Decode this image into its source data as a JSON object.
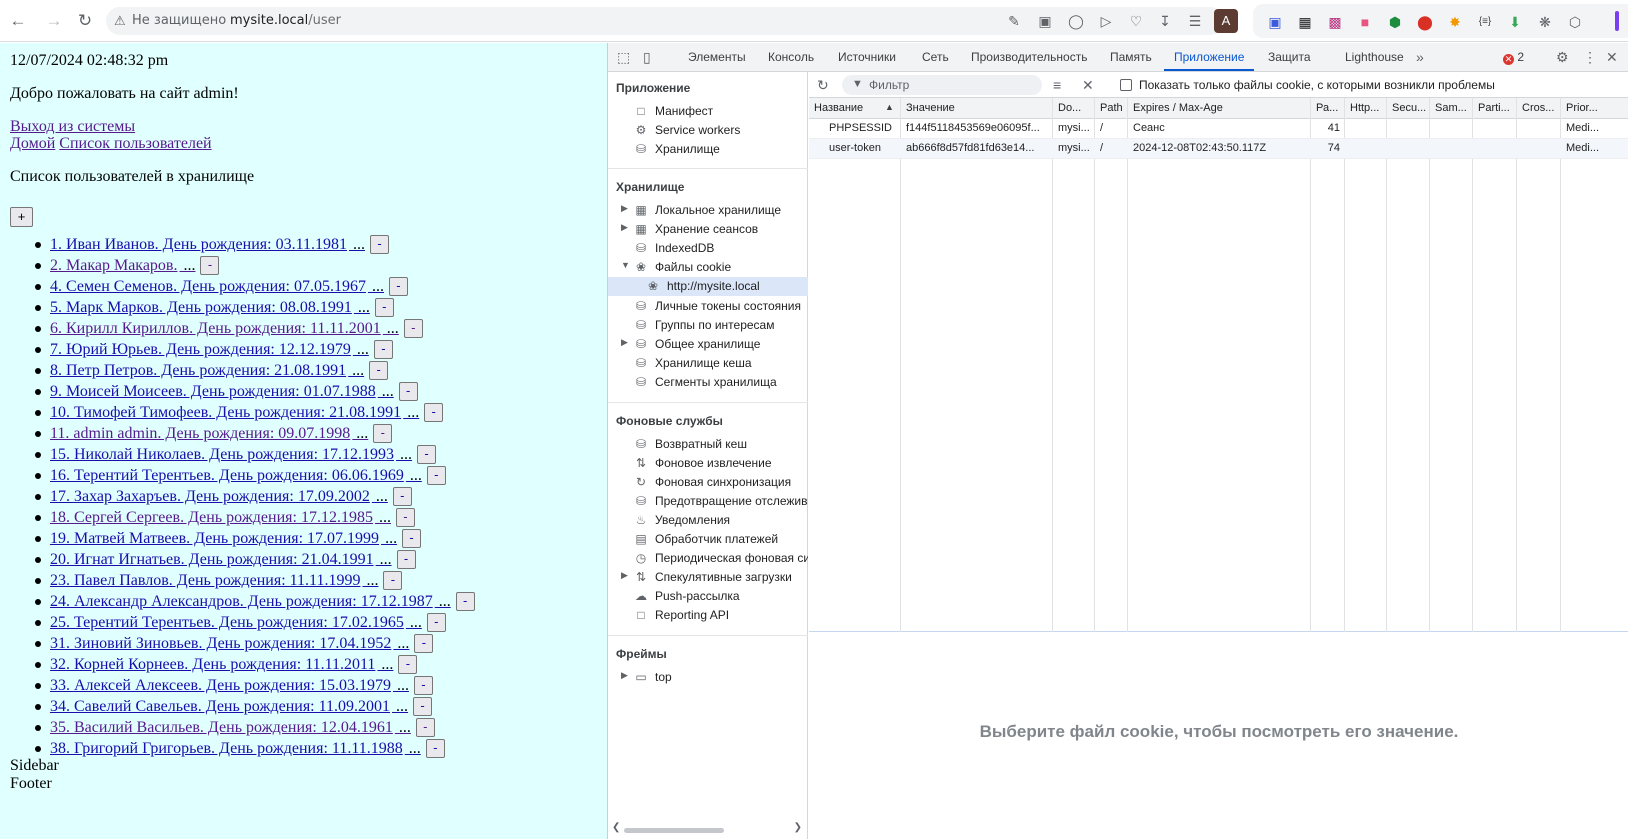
{
  "browser": {
    "insecure_label": "Не защищено",
    "url_host": "mysite.local",
    "url_path": "/user",
    "profile_letter": "A"
  },
  "page": {
    "datetime": "12/07/2024 02:48:32 pm",
    "welcome": "Добро пожаловать на сайт admin!",
    "logout_link": "Выход из системы",
    "home_link": "Домой",
    "users_link": "Список пользователей",
    "list_title": "Список пользователей в хранилище",
    "add_label": "+",
    "delete_label": "-",
    "users": [
      "1. Иван Иванов. День рождения: 03.11.1981",
      "2. Макар Макаров.",
      "4. Семен Семенов. День рождения: 07.05.1967",
      "5. Марк Марков. День рождения: 08.08.1991",
      "6. Кирилл Кириллов. День рождения: 11.11.2001",
      "7. Юрий Юрьев. День рождения: 12.12.1979",
      "8. Петр Петров. День рождения: 21.08.1991",
      "9. Моисей Моисеев. День рождения: 01.07.1988",
      "10. Тимофей Тимофеев. День рождения: 21.08.1991",
      "11. admin admin. День рождения: 09.07.1998",
      "15. Николай Николаев. День рождения: 17.12.1993",
      "16. Терентий Терентьев. День рождения: 06.06.1969",
      "17. Захар Захаръев. День рождения: 17.09.2002",
      "18. Сергей Сергеев. День рождения: 17.12.1985",
      "19. Матвей Матвеев. День рождения: 17.07.1999",
      "20. Игнат Игнатьев. День рождения: 21.04.1991",
      "23. Павел Павлов. День рождения: 11.11.1999",
      "24. Александр Александров. День рождения: 17.12.1987",
      "25. Терентий Терентьев. День рождения: 17.02.1965",
      "31. Зиновий Зиновьев. День рождения: 17.04.1952",
      "32. Корней Корнеев. День рождения: 11.11.2011",
      "33. Алексей Алексеев. День рождения: 15.03.1979",
      "34. Савелий Савельев. День рождения: 11.09.2001",
      "35. Василий Васильев. День рождения: 12.04.1961",
      "38. Григорий Григорьев. День рождения: 11.11.1988"
    ],
    "sidebar_text": "Sidebar",
    "footer_text": "Footer"
  },
  "devtools": {
    "tabs": [
      "Элементы",
      "Консоль",
      "Источники",
      "Сеть",
      "Производительность",
      "Память",
      "Приложение",
      "Защита",
      "Lighthouse"
    ],
    "active_tab": "Приложение",
    "error_count": "2",
    "sidebar": {
      "app_heading": "Приложение",
      "app_items": [
        "Манифест",
        "Service workers",
        "Хранилище"
      ],
      "storage_heading": "Хранилище",
      "storage_items": [
        "Локальное хранилище",
        "Хранение сеансов",
        "IndexedDB",
        "Файлы cookie"
      ],
      "cookie_origin": "http://mysite.local",
      "storage_items2": [
        "Личные токены состояния",
        "Группы по интересам",
        "Общее хранилище",
        "Хранилище кеша",
        "Сегменты хранилища"
      ],
      "bg_heading": "Фоновые службы",
      "bg_items": [
        "Возвратный кеш",
        "Фоновое извлечение",
        "Фоновая синхронизация",
        "Предотвращение отслежив",
        "Уведомления",
        "Обработчик платежей",
        "Периодическая фоновая си",
        "Спекулятивные загрузки",
        "Push-рассылка",
        "Reporting API"
      ],
      "frames_heading": "Фреймы",
      "frame_top": "top"
    },
    "toolbar": {
      "filter_placeholder": "Фильтр",
      "only_issues_label": "Показать только файлы cookie, с которыми возникли проблемы"
    },
    "columns": [
      "Название",
      "Значение",
      "Do...",
      "Path",
      "Expires / Max-Age",
      "Ра...",
      "Http...",
      "Secu...",
      "Sam...",
      "Parti...",
      "Cros...",
      "Prior..."
    ],
    "cookies": [
      {
        "name": "PHPSESSID",
        "value": "f144f5118453569e06095f...",
        "domain": "mysi...",
        "path": "/",
        "expires": "Сеанс",
        "size": "41",
        "priority": "Medi..."
      },
      {
        "name": "user-token",
        "value": "ab666f8d57fd81fd63e14...",
        "domain": "mysi...",
        "path": "/",
        "expires": "2024-12-08T02:43:50.117Z",
        "size": "74",
        "priority": "Medi..."
      }
    ],
    "empty_message": "Выберите файл cookie, чтобы посмотреть его значение."
  }
}
